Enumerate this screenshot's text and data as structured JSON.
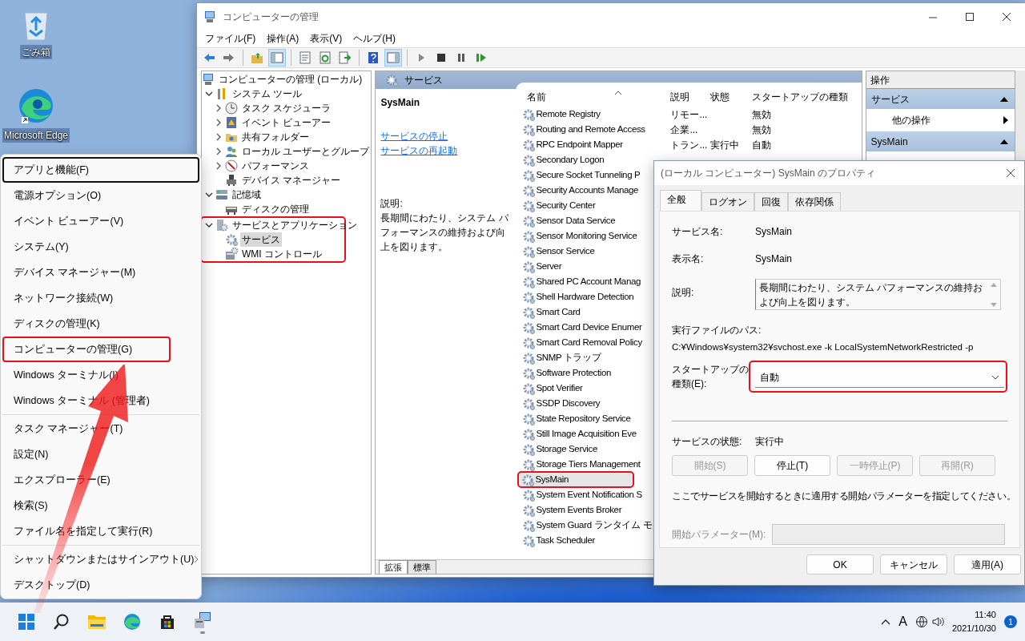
{
  "desktop_icons": [
    {
      "label": "ごみ箱",
      "kind": "recycle"
    },
    {
      "label": "Microsoft Edge",
      "kind": "edge"
    }
  ],
  "mmc_window": {
    "title": "コンピューターの管理",
    "menu": [
      "ファイル(F)",
      "操作(A)",
      "表示(V)",
      "ヘルプ(H)"
    ],
    "toolbar": [
      [
        {
          "kind": "back",
          "pressed": false
        },
        {
          "kind": "forward",
          "pressed": false
        }
      ],
      [
        {
          "kind": "up",
          "pressed": false
        },
        {
          "kind": "tree",
          "pressed": true
        }
      ],
      [
        {
          "kind": "props",
          "pressed": false
        },
        {
          "kind": "refresh",
          "pressed": false
        },
        {
          "kind": "export",
          "pressed": false
        }
      ],
      [
        {
          "kind": "help",
          "pressed": false
        },
        {
          "kind": "actions",
          "pressed": true
        }
      ],
      [
        {
          "kind": "play",
          "pressed": false
        },
        {
          "kind": "stop",
          "pressed": false
        },
        {
          "kind": "pause",
          "pressed": false
        },
        {
          "kind": "resume",
          "pressed": false
        }
      ]
    ],
    "tree": {
      "label": "コンピューターの管理 (ローカル)",
      "kind": "computer",
      "selected": false,
      "children": [
        {
          "label": "システム ツール",
          "kind": "tools",
          "expanded": true,
          "highlighted": false,
          "selected": false,
          "children": [
            {
              "label": "タスク スケジューラ",
              "kind": "clock",
              "expanded": false,
              "selected": false
            },
            {
              "label": "イベント ビューアー",
              "kind": "event",
              "expanded": false,
              "selected": false
            },
            {
              "label": "共有フォルダー",
              "kind": "share",
              "expanded": false,
              "selected": false
            },
            {
              "label": "ローカル ユーザーとグループ",
              "kind": "users",
              "expanded": false,
              "selected": false
            },
            {
              "label": "パフォーマンス",
              "kind": "perf",
              "expanded": false,
              "selected": false
            },
            {
              "label": "デバイス マネージャー",
              "kind": "device",
              "selected": false
            }
          ]
        },
        {
          "label": "記憶域",
          "kind": "storage",
          "expanded": true,
          "highlighted": false,
          "selected": false,
          "children": [
            {
              "label": "ディスクの管理",
              "kind": "disk",
              "selected": false
            }
          ]
        },
        {
          "label": "サービスとアプリケーション",
          "kind": "apps",
          "expanded": true,
          "highlighted": true,
          "selected": false,
          "children": [
            {
              "label": "サービス",
              "kind": "gear",
              "selected": true
            },
            {
              "label": "WMI コントロール",
              "kind": "wmi",
              "selected": false
            }
          ]
        }
      ]
    },
    "pane_title": "サービス",
    "detail": {
      "title": "SysMain",
      "links": [
        "サービスの停止",
        "サービスの再起動"
      ],
      "description_label": "説明:",
      "description": "長期間にわたり、システム パフォーマンスの維持および向上を図ります。"
    },
    "columns": [
      "名前",
      "説明",
      "状態",
      "スタートアップの種類"
    ],
    "services": [
      {
        "name": "Remote Registry",
        "description": "リモー...",
        "startup": "無効",
        "selected": false,
        "highlighted": false
      },
      {
        "name": "Routing and Remote Access",
        "description": "企業...",
        "startup": "無効",
        "selected": false,
        "highlighted": false
      },
      {
        "name": "RPC Endpoint Mapper",
        "description": "トラン...",
        "status": "実行中",
        "startup": "自動",
        "selected": false,
        "highlighted": false
      },
      {
        "name": "Secondary Logon",
        "selected": false,
        "highlighted": false
      },
      {
        "name": "Secure Socket Tunneling P",
        "selected": false,
        "highlighted": false
      },
      {
        "name": "Security Accounts Manage",
        "selected": false,
        "highlighted": false
      },
      {
        "name": "Security Center",
        "selected": false,
        "highlighted": false
      },
      {
        "name": "Sensor Data Service",
        "selected": false,
        "highlighted": false
      },
      {
        "name": "Sensor Monitoring Service",
        "selected": false,
        "highlighted": false
      },
      {
        "name": "Sensor Service",
        "selected": false,
        "highlighted": false
      },
      {
        "name": "Server",
        "selected": false,
        "highlighted": false
      },
      {
        "name": "Shared PC Account Manag",
        "selected": false,
        "highlighted": false
      },
      {
        "name": "Shell Hardware Detection",
        "selected": false,
        "highlighted": false
      },
      {
        "name": "Smart Card",
        "selected": false,
        "highlighted": false
      },
      {
        "name": "Smart Card Device Enumer",
        "selected": false,
        "highlighted": false
      },
      {
        "name": "Smart Card Removal Policy",
        "selected": false,
        "highlighted": false
      },
      {
        "name": "SNMP トラップ",
        "selected": false,
        "highlighted": false
      },
      {
        "name": "Software Protection",
        "selected": false,
        "highlighted": false
      },
      {
        "name": "Spot Verifier",
        "selected": false,
        "highlighted": false
      },
      {
        "name": "SSDP Discovery",
        "selected": false,
        "highlighted": false
      },
      {
        "name": "State Repository Service",
        "selected": false,
        "highlighted": false
      },
      {
        "name": "Still Image Acquisition Eve",
        "selected": false,
        "highlighted": false
      },
      {
        "name": "Storage Service",
        "selected": false,
        "highlighted": false
      },
      {
        "name": "Storage Tiers Management",
        "selected": false,
        "highlighted": false
      },
      {
        "name": "SysMain",
        "selected": true,
        "highlighted": true
      },
      {
        "name": "System Event Notification S",
        "selected": false,
        "highlighted": false
      },
      {
        "name": "System Events Broker",
        "selected": false,
        "highlighted": false
      },
      {
        "name": "System Guard ランタイム モ",
        "selected": false,
        "highlighted": false
      },
      {
        "name": "Task Scheduler",
        "selected": false,
        "highlighted": false
      }
    ],
    "view_tabs": [
      {
        "label": "拡張",
        "selected": true
      },
      {
        "label": "標準",
        "selected": false
      }
    ],
    "actions": {
      "header": "操作",
      "sections": [
        {
          "title": "サービス",
          "items": [
            "他の操作"
          ]
        },
        {
          "title": "SysMain"
        }
      ]
    }
  },
  "dialog": {
    "title": "(ローカル コンピューター) SysMain のプロパティ",
    "tabs": [
      {
        "label": "全般",
        "selected": true
      },
      {
        "label": "ログオン",
        "selected": false
      },
      {
        "label": "回復",
        "selected": false
      },
      {
        "label": "依存関係",
        "selected": false
      }
    ],
    "fields": [
      {
        "label": "サービス名:",
        "value": "SysMain"
      },
      {
        "label": "表示名:",
        "value": "SysMain"
      }
    ],
    "description_label": "説明:",
    "description": "長期間にわたり、システム パフォーマンスの維持および向上を図ります。",
    "path_label": "実行ファイルのパス:",
    "path": "C:¥Windows¥system32¥svchost.exe -k LocalSystemNetworkRestricted -p",
    "startup_label": "スタートアップの種類(E):",
    "startup_value": "自動",
    "startup_highlighted": true,
    "status_label": "サービスの状態:",
    "status": "実行中",
    "control_buttons": [
      {
        "label": "開始(S)",
        "disabled": true
      },
      {
        "label": "停止(T)",
        "disabled": false
      },
      {
        "label": "一時停止(P)",
        "disabled": true
      },
      {
        "label": "再開(R)",
        "disabled": true
      }
    ],
    "hint": "ここでサービスを開始するときに適用する開始パラメーターを指定してください。",
    "param_label": "開始パラメーター(M):",
    "param_disabled": true,
    "buttons": [
      "OK",
      "キャンセル",
      "適用(A)"
    ]
  },
  "context_menu": {
    "groups": [
      [
        {
          "label": "アプリと機能(F)",
          "focused": true,
          "highlighted": false,
          "submenu": false
        },
        {
          "label": "電源オプション(O)",
          "focused": false,
          "highlighted": false,
          "submenu": false
        },
        {
          "label": "イベント ビューアー(V)",
          "focused": false,
          "highlighted": false,
          "submenu": false
        },
        {
          "label": "システム(Y)",
          "focused": false,
          "highlighted": false,
          "submenu": false
        },
        {
          "label": "デバイス マネージャー(M)",
          "focused": false,
          "highlighted": false,
          "submenu": false
        },
        {
          "label": "ネットワーク接続(W)",
          "focused": false,
          "highlighted": false,
          "submenu": false
        },
        {
          "label": "ディスクの管理(K)",
          "focused": false,
          "highlighted": false,
          "submenu": false
        },
        {
          "label": "コンピューターの管理(G)",
          "focused": false,
          "highlighted": true,
          "submenu": false
        },
        {
          "label": "Windows ターミナル(I)",
          "focused": false,
          "highlighted": false,
          "submenu": false
        },
        {
          "label": "Windows ターミナル (管理者)",
          "focused": false,
          "highlighted": false,
          "submenu": false
        }
      ],
      [
        {
          "label": "タスク マネージャー(T)",
          "focused": false,
          "highlighted": false,
          "submenu": false
        },
        {
          "label": "設定(N)",
          "focused": false,
          "highlighted": false,
          "submenu": false
        },
        {
          "label": "エクスプローラー(E)",
          "focused": false,
          "highlighted": false,
          "submenu": false
        },
        {
          "label": "検索(S)",
          "focused": false,
          "highlighted": false,
          "submenu": false
        },
        {
          "label": "ファイル名を指定して実行(R)",
          "focused": false,
          "highlighted": false,
          "submenu": false
        }
      ],
      [
        {
          "label": "シャットダウンまたはサインアウト(U)",
          "focused": false,
          "highlighted": false,
          "submenu": true
        },
        {
          "label": "デスクトップ(D)",
          "focused": false,
          "highlighted": false,
          "submenu": false
        }
      ]
    ]
  },
  "annotation_arrow": true,
  "taskbar": {
    "apps": [
      {
        "kind": "start",
        "running": false
      },
      {
        "kind": "search",
        "running": false
      },
      {
        "kind": "explorer",
        "running": false
      },
      {
        "kind": "edge",
        "running": false
      },
      {
        "kind": "store",
        "running": false
      },
      {
        "kind": "mmc",
        "running": true
      }
    ],
    "ime": "A",
    "time": "11:40",
    "date": "2021/10/30",
    "notifications": "1"
  }
}
